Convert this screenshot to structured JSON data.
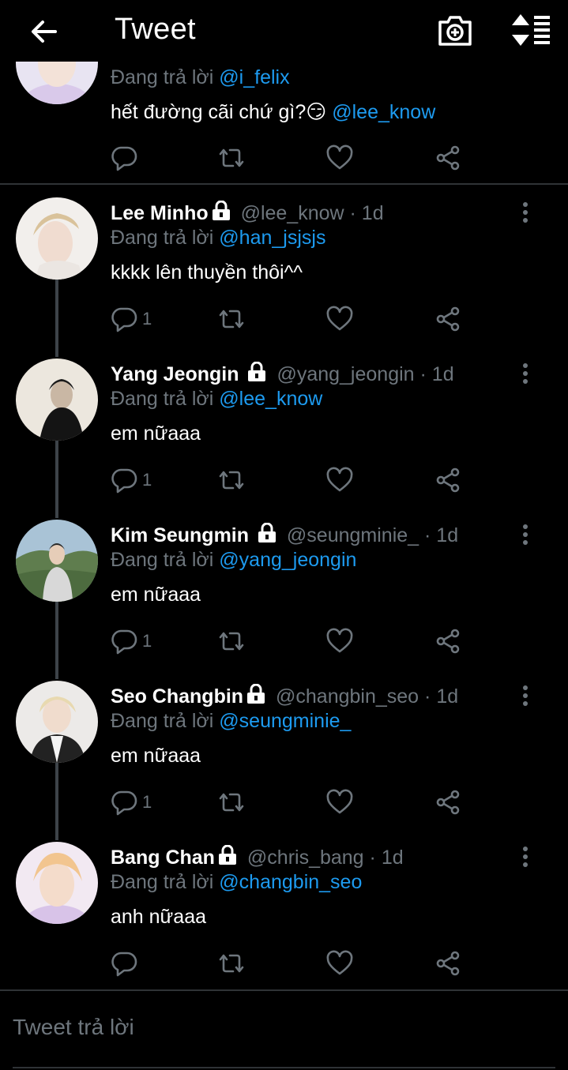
{
  "header": {
    "title": "Tweet",
    "back_icon": "arrow-left-icon",
    "camera_icon": "camera-add-icon",
    "sort_icon": "sort-icon"
  },
  "colors": {
    "background": "#000000",
    "mention": "#1d9bf0",
    "muted": "#6e767d",
    "divider": "#2f3336"
  },
  "tweets": [
    {
      "name": "",
      "handle": "",
      "time": "",
      "reply_prefix": "Đang trả lời",
      "reply_to": "@i_felix",
      "text": "hết đường cãi chứ gì?😏 ",
      "text_mention": "@lee_know",
      "replies": ""
    },
    {
      "name": "Lee Minho",
      "handle": "@lee_know",
      "time": "· 1d",
      "reply_prefix": "Đang trả lời",
      "reply_to": "@han_jsjsjs",
      "text": "kkkk lên thuyền thôi^^",
      "replies": "1"
    },
    {
      "name": "Yang Jeongin",
      "handle": "@yang_jeongin",
      "time": "· 1d",
      "reply_prefix": "Đang trả lời",
      "reply_to": "@lee_know",
      "text": "em nữaaa",
      "replies": "1"
    },
    {
      "name": "Kim Seungmin",
      "handle": "@seungminie_",
      "time": "· 1d",
      "reply_prefix": "Đang trả lời",
      "reply_to": "@yang_jeongin",
      "text": "em nữaaa",
      "replies": "1"
    },
    {
      "name": "Seo Changbin",
      "handle": "@changbin_seo",
      "time": "· 1d",
      "reply_prefix": "Đang trả lời",
      "reply_to": "@seungminie_",
      "text": "em nữaaa",
      "replies": "1"
    },
    {
      "name": "Bang Chan",
      "handle": "@chris_bang",
      "time": "· 1d",
      "reply_prefix": "Đang trả lời",
      "reply_to": "@changbin_seo",
      "text": "anh nữaaa",
      "replies": ""
    }
  ],
  "composer": {
    "placeholder": "Tweet trả lời"
  }
}
